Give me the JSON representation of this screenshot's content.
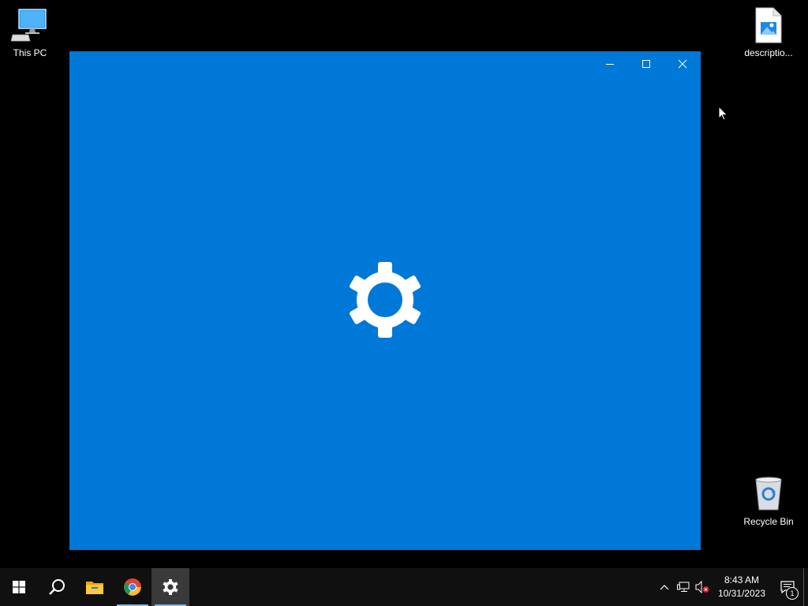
{
  "desktop": {
    "icons": [
      {
        "label": "This PC",
        "icon": "this-pc-icon"
      },
      {
        "label": "descriptio...",
        "icon": "image-file-icon"
      },
      {
        "label": "Recycle Bin",
        "icon": "recycle-bin-icon"
      }
    ]
  },
  "window": {
    "app": "Settings",
    "background_color": "#0078d7",
    "controls": [
      "minimize-icon",
      "maximize-icon",
      "close-icon"
    ],
    "splash_icon": "gear-icon"
  },
  "taskbar": {
    "items": [
      {
        "icon": "windows-start-icon",
        "active": false
      },
      {
        "icon": "search-icon",
        "active": false
      },
      {
        "icon": "file-explorer-icon",
        "active": false
      },
      {
        "icon": "chrome-icon",
        "active": false,
        "running": true
      },
      {
        "icon": "settings-gear-icon",
        "active": true,
        "running": true
      }
    ],
    "tray": {
      "icons": [
        "chevron-up-icon",
        "network-icon",
        "volume-muted-icon"
      ],
      "time": "8:43 AM",
      "date": "10/31/2023",
      "notification_count": "1"
    }
  }
}
